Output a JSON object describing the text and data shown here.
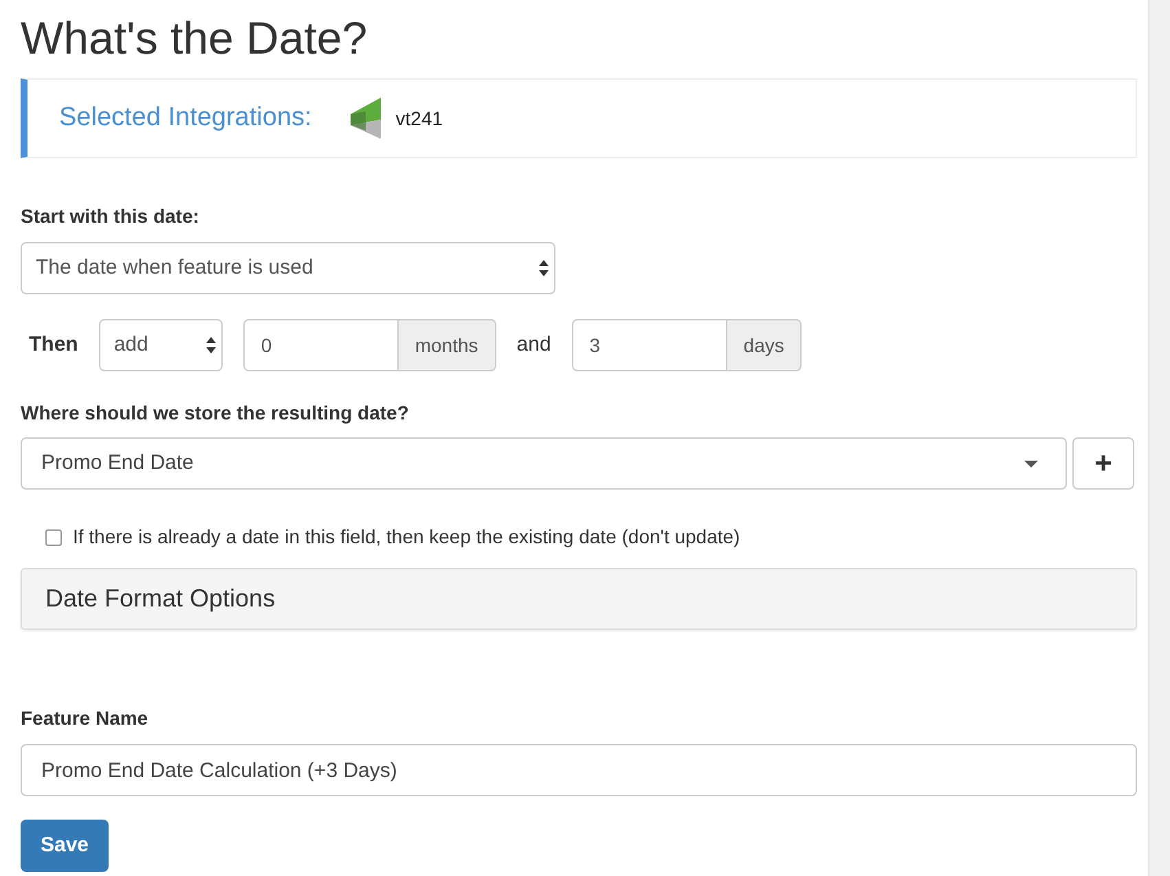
{
  "title": "What's the Date?",
  "integrations": {
    "label": "Selected Integrations:",
    "items": [
      {
        "name": "vt241"
      }
    ]
  },
  "start": {
    "label": "Start with this date:",
    "value": "The date when feature is used"
  },
  "offset": {
    "label": "Then",
    "operation": "add",
    "months": {
      "value": "0",
      "unit": "months"
    },
    "joiner": "and",
    "days": {
      "value": "3",
      "unit": "days"
    }
  },
  "store": {
    "label": "Where should we store the resulting date?",
    "value": "Promo End Date",
    "add_button": "+"
  },
  "keep_existing": {
    "label": "If there is already a date in this field, then keep the existing date (don't update)",
    "checked": false
  },
  "date_format": {
    "title": "Date Format Options",
    "expanded": false
  },
  "feature_name": {
    "label": "Feature Name",
    "value": "Promo End Date Calculation (+3 Days)"
  },
  "save_button": "Save"
}
